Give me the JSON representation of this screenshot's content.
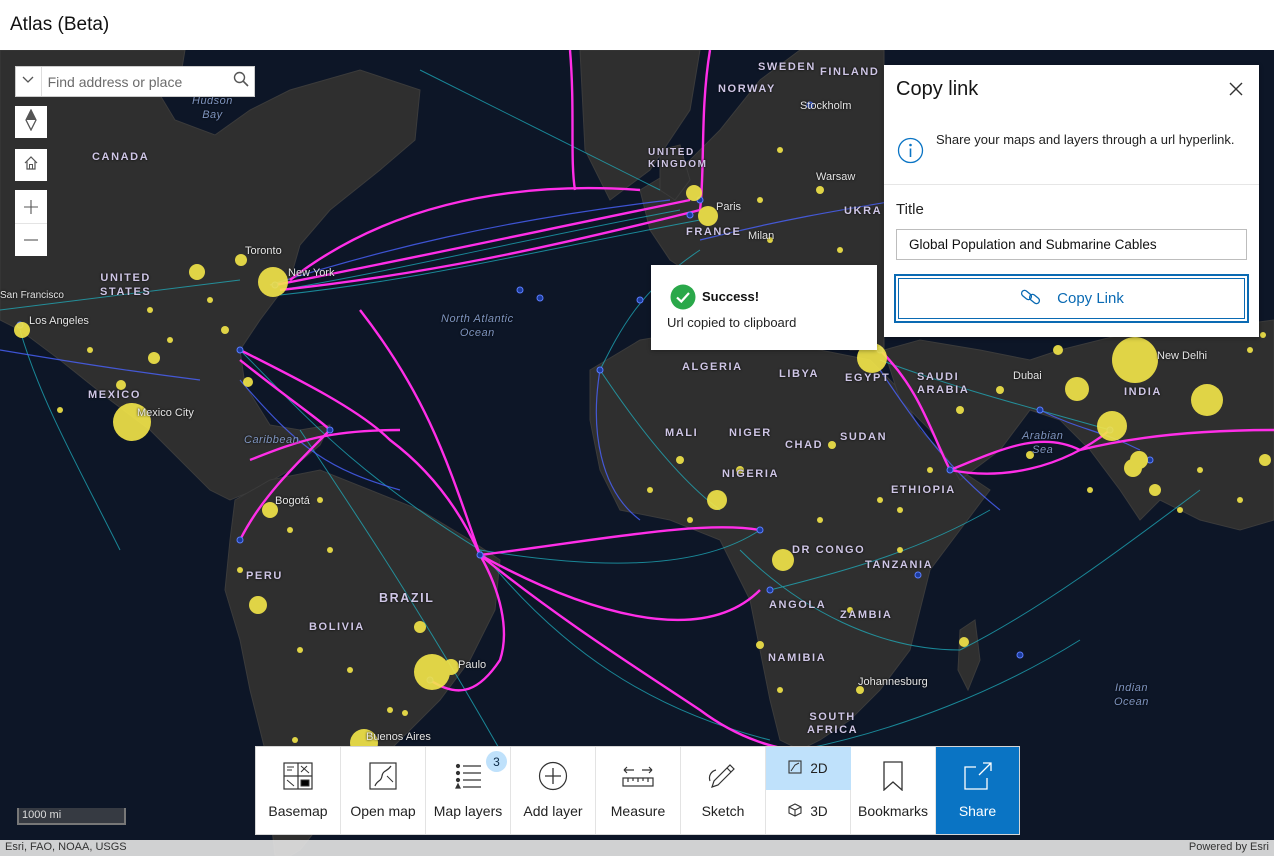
{
  "app": {
    "title": "Atlas (Beta)"
  },
  "search": {
    "placeholder": "Find address or place"
  },
  "map_labels": {
    "hudson_bay": "Hudson\nBay",
    "canada": "CANADA",
    "united_states": "UNITED\nSTATES",
    "toronto": "Toronto",
    "new_york": "New York",
    "san_francisco": "San Francisco",
    "los_angeles": "Los Angeles",
    "mexico": "MEXICO",
    "mexico_city": "Mexico City",
    "caribbean": "Caribbean",
    "bogota": "Bogotá",
    "peru": "PERU",
    "bolivia": "BOLIVIA",
    "brazil": "BRAZIL",
    "sao_paulo": "Paulo",
    "buenos_aires": "Buenos Aires",
    "north_atlantic": "North Atlantic\nOcean",
    "sweden": "SWEDEN",
    "finland": "FINLAND",
    "norway": "NORWAY",
    "stockholm": "Stockholm",
    "united_kingdom": "UNITED\nKINGDOM",
    "warsaw": "Warsaw",
    "paris": "Paris",
    "ukraine": "UKRA",
    "france": "FRANCE",
    "milan": "Milan",
    "algeria": "ALGERIA",
    "libya": "LIBYA",
    "egypt": "EGYPT",
    "saudi_arabia": "SAUDI\nARABIA",
    "dubai": "Dubai",
    "new_delhi": "New Delhi",
    "india": "INDIA",
    "arabian_sea": "Arabian\nSea",
    "mali": "MALI",
    "niger": "NIGER",
    "chad": "CHAD",
    "sudan": "SUDAN",
    "nigeria": "NIGERIA",
    "ethiopia": "ETHIOPIA",
    "dr_congo": "DR CONGO",
    "tanzania": "TANZANIA",
    "angola": "ANGOLA",
    "zambia": "ZAMBIA",
    "namibia": "NAMIBIA",
    "johannesburg": "Johannesburg",
    "south_africa": "SOUTH\nAFRICA",
    "indian_ocean": "Indian\nOcean"
  },
  "panel": {
    "title": "Copy link",
    "info": "Share your maps and layers through a url hyperlink.",
    "title_label": "Title",
    "title_value": "Global Population and Submarine Cables",
    "copy_button": "Copy Link"
  },
  "toast": {
    "title": "Success!",
    "message": "Url copied to clipboard"
  },
  "toolbar": {
    "basemap": "Basemap",
    "open_map": "Open map",
    "map_layers": "Map layers",
    "map_layers_count": "3",
    "add_layer": "Add layer",
    "measure": "Measure",
    "sketch": "Sketch",
    "dim_2d": "2D",
    "dim_3d": "3D",
    "bookmarks": "Bookmarks",
    "share": "Share"
  },
  "scale": "1000 mi",
  "attribution": {
    "left": "Esri, FAO, NOAA, USGS",
    "right": "Powered by Esri"
  },
  "colors": {
    "ocean": "#0d1627",
    "land": "#2f2f2f",
    "cable_magenta": "#ff2ee8",
    "cable_blue": "#4a63ff",
    "cable_teal": "#1fb7c7",
    "population": "#f4e649",
    "accent": "#0a74c4"
  }
}
